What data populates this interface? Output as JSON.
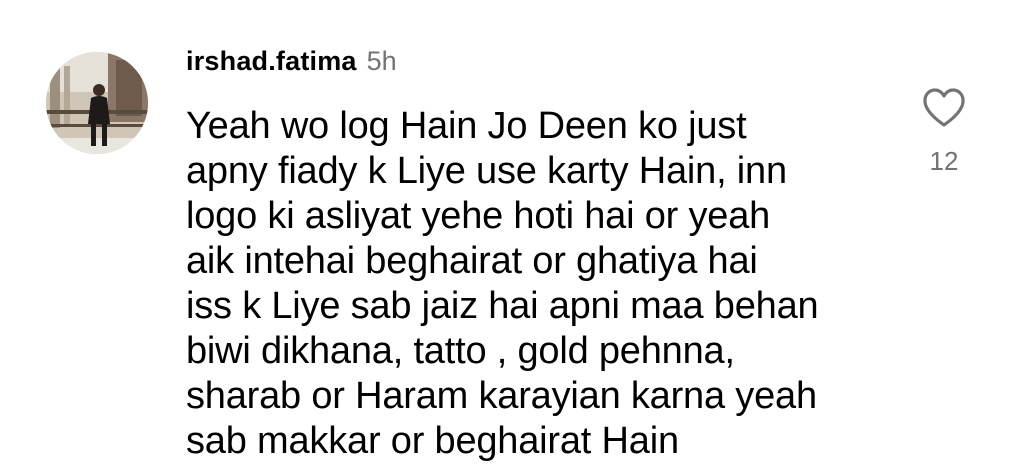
{
  "comment": {
    "username": "irshad.fatima",
    "timestamp": "5h",
    "text": "Yeah wo log Hain Jo Deen ko just\napny fiady k Liye use karty Hain, inn\nlogo ki asliyat yehe hoti hai or yeah\naik intehai beghairat or ghatiya hai\niss k Liye sab jaiz hai apni maa behan\nbiwi dikhana, tatto , gold pehnna,\nsharab or Haram karayian karna yeah\nsab makkar or beghairat Hain",
    "like_count": "12",
    "like_icon": "heart-outline-icon",
    "colors": {
      "text": "#000000",
      "secondary": "#737373",
      "background": "#ffffff"
    }
  }
}
